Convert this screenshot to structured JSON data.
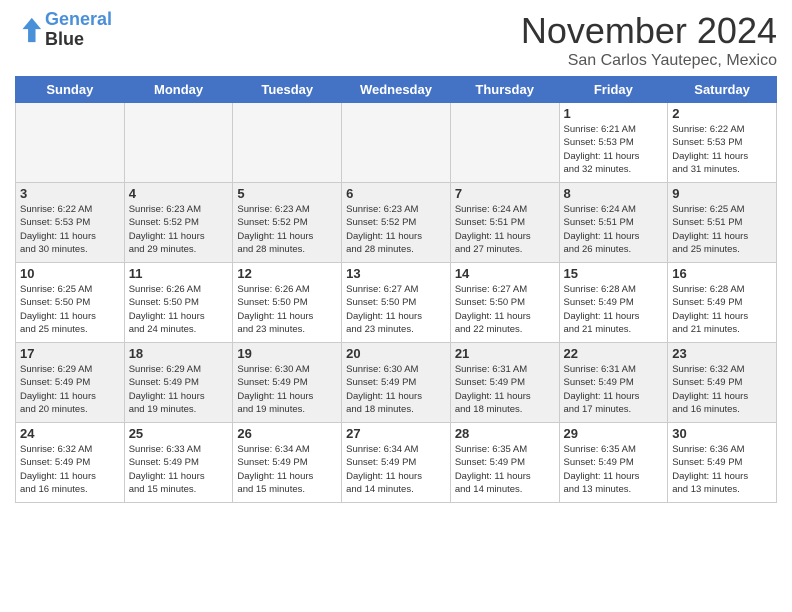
{
  "header": {
    "logo_line1": "General",
    "logo_line2": "Blue",
    "month": "November 2024",
    "location": "San Carlos Yautepec, Mexico"
  },
  "days_of_week": [
    "Sunday",
    "Monday",
    "Tuesday",
    "Wednesday",
    "Thursday",
    "Friday",
    "Saturday"
  ],
  "weeks": [
    [
      {
        "num": "",
        "info": "",
        "empty": true
      },
      {
        "num": "",
        "info": "",
        "empty": true
      },
      {
        "num": "",
        "info": "",
        "empty": true
      },
      {
        "num": "",
        "info": "",
        "empty": true
      },
      {
        "num": "",
        "info": "",
        "empty": true
      },
      {
        "num": "1",
        "info": "Sunrise: 6:21 AM\nSunset: 5:53 PM\nDaylight: 11 hours\nand 32 minutes.",
        "empty": false
      },
      {
        "num": "2",
        "info": "Sunrise: 6:22 AM\nSunset: 5:53 PM\nDaylight: 11 hours\nand 31 minutes.",
        "empty": false
      }
    ],
    [
      {
        "num": "3",
        "info": "Sunrise: 6:22 AM\nSunset: 5:53 PM\nDaylight: 11 hours\nand 30 minutes.",
        "empty": false
      },
      {
        "num": "4",
        "info": "Sunrise: 6:23 AM\nSunset: 5:52 PM\nDaylight: 11 hours\nand 29 minutes.",
        "empty": false
      },
      {
        "num": "5",
        "info": "Sunrise: 6:23 AM\nSunset: 5:52 PM\nDaylight: 11 hours\nand 28 minutes.",
        "empty": false
      },
      {
        "num": "6",
        "info": "Sunrise: 6:23 AM\nSunset: 5:52 PM\nDaylight: 11 hours\nand 28 minutes.",
        "empty": false
      },
      {
        "num": "7",
        "info": "Sunrise: 6:24 AM\nSunset: 5:51 PM\nDaylight: 11 hours\nand 27 minutes.",
        "empty": false
      },
      {
        "num": "8",
        "info": "Sunrise: 6:24 AM\nSunset: 5:51 PM\nDaylight: 11 hours\nand 26 minutes.",
        "empty": false
      },
      {
        "num": "9",
        "info": "Sunrise: 6:25 AM\nSunset: 5:51 PM\nDaylight: 11 hours\nand 25 minutes.",
        "empty": false
      }
    ],
    [
      {
        "num": "10",
        "info": "Sunrise: 6:25 AM\nSunset: 5:50 PM\nDaylight: 11 hours\nand 25 minutes.",
        "empty": false
      },
      {
        "num": "11",
        "info": "Sunrise: 6:26 AM\nSunset: 5:50 PM\nDaylight: 11 hours\nand 24 minutes.",
        "empty": false
      },
      {
        "num": "12",
        "info": "Sunrise: 6:26 AM\nSunset: 5:50 PM\nDaylight: 11 hours\nand 23 minutes.",
        "empty": false
      },
      {
        "num": "13",
        "info": "Sunrise: 6:27 AM\nSunset: 5:50 PM\nDaylight: 11 hours\nand 23 minutes.",
        "empty": false
      },
      {
        "num": "14",
        "info": "Sunrise: 6:27 AM\nSunset: 5:50 PM\nDaylight: 11 hours\nand 22 minutes.",
        "empty": false
      },
      {
        "num": "15",
        "info": "Sunrise: 6:28 AM\nSunset: 5:49 PM\nDaylight: 11 hours\nand 21 minutes.",
        "empty": false
      },
      {
        "num": "16",
        "info": "Sunrise: 6:28 AM\nSunset: 5:49 PM\nDaylight: 11 hours\nand 21 minutes.",
        "empty": false
      }
    ],
    [
      {
        "num": "17",
        "info": "Sunrise: 6:29 AM\nSunset: 5:49 PM\nDaylight: 11 hours\nand 20 minutes.",
        "empty": false
      },
      {
        "num": "18",
        "info": "Sunrise: 6:29 AM\nSunset: 5:49 PM\nDaylight: 11 hours\nand 19 minutes.",
        "empty": false
      },
      {
        "num": "19",
        "info": "Sunrise: 6:30 AM\nSunset: 5:49 PM\nDaylight: 11 hours\nand 19 minutes.",
        "empty": false
      },
      {
        "num": "20",
        "info": "Sunrise: 6:30 AM\nSunset: 5:49 PM\nDaylight: 11 hours\nand 18 minutes.",
        "empty": false
      },
      {
        "num": "21",
        "info": "Sunrise: 6:31 AM\nSunset: 5:49 PM\nDaylight: 11 hours\nand 18 minutes.",
        "empty": false
      },
      {
        "num": "22",
        "info": "Sunrise: 6:31 AM\nSunset: 5:49 PM\nDaylight: 11 hours\nand 17 minutes.",
        "empty": false
      },
      {
        "num": "23",
        "info": "Sunrise: 6:32 AM\nSunset: 5:49 PM\nDaylight: 11 hours\nand 16 minutes.",
        "empty": false
      }
    ],
    [
      {
        "num": "24",
        "info": "Sunrise: 6:32 AM\nSunset: 5:49 PM\nDaylight: 11 hours\nand 16 minutes.",
        "empty": false
      },
      {
        "num": "25",
        "info": "Sunrise: 6:33 AM\nSunset: 5:49 PM\nDaylight: 11 hours\nand 15 minutes.",
        "empty": false
      },
      {
        "num": "26",
        "info": "Sunrise: 6:34 AM\nSunset: 5:49 PM\nDaylight: 11 hours\nand 15 minutes.",
        "empty": false
      },
      {
        "num": "27",
        "info": "Sunrise: 6:34 AM\nSunset: 5:49 PM\nDaylight: 11 hours\nand 14 minutes.",
        "empty": false
      },
      {
        "num": "28",
        "info": "Sunrise: 6:35 AM\nSunset: 5:49 PM\nDaylight: 11 hours\nand 14 minutes.",
        "empty": false
      },
      {
        "num": "29",
        "info": "Sunrise: 6:35 AM\nSunset: 5:49 PM\nDaylight: 11 hours\nand 13 minutes.",
        "empty": false
      },
      {
        "num": "30",
        "info": "Sunrise: 6:36 AM\nSunset: 5:49 PM\nDaylight: 11 hours\nand 13 minutes.",
        "empty": false
      }
    ]
  ]
}
